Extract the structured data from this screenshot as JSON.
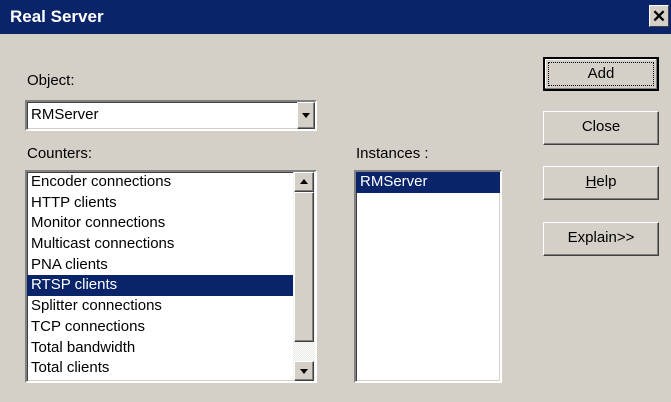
{
  "window": {
    "title": "Real Server",
    "close_glyph": "✕"
  },
  "object": {
    "label": "Object:",
    "value": "RMServer"
  },
  "counters": {
    "label": "Counters:",
    "items": [
      "Encoder connections",
      "HTTP clients",
      "Monitor connections",
      "Multicast connections",
      "PNA clients",
      "RTSP clients",
      "Splitter connections",
      "TCP connections",
      "Total bandwidth",
      "Total clients"
    ],
    "selected": "RTSP clients"
  },
  "instances": {
    "label": "Instances :",
    "items": [
      "RMServer"
    ],
    "selected": "RMServer"
  },
  "buttons": {
    "add": "Add",
    "close": "Close",
    "help_prefix": "",
    "help_underlined": "H",
    "help_rest": "elp",
    "explain": "Explain>>"
  },
  "colors": {
    "titlebar": "#0a246a",
    "selection": "#0a246a",
    "face": "#d4d0c8"
  },
  "icons": {
    "close": "close-icon",
    "dropdown": "chevron-down-icon",
    "scroll_up": "scroll-up-icon",
    "scroll_down": "scroll-down-icon"
  }
}
